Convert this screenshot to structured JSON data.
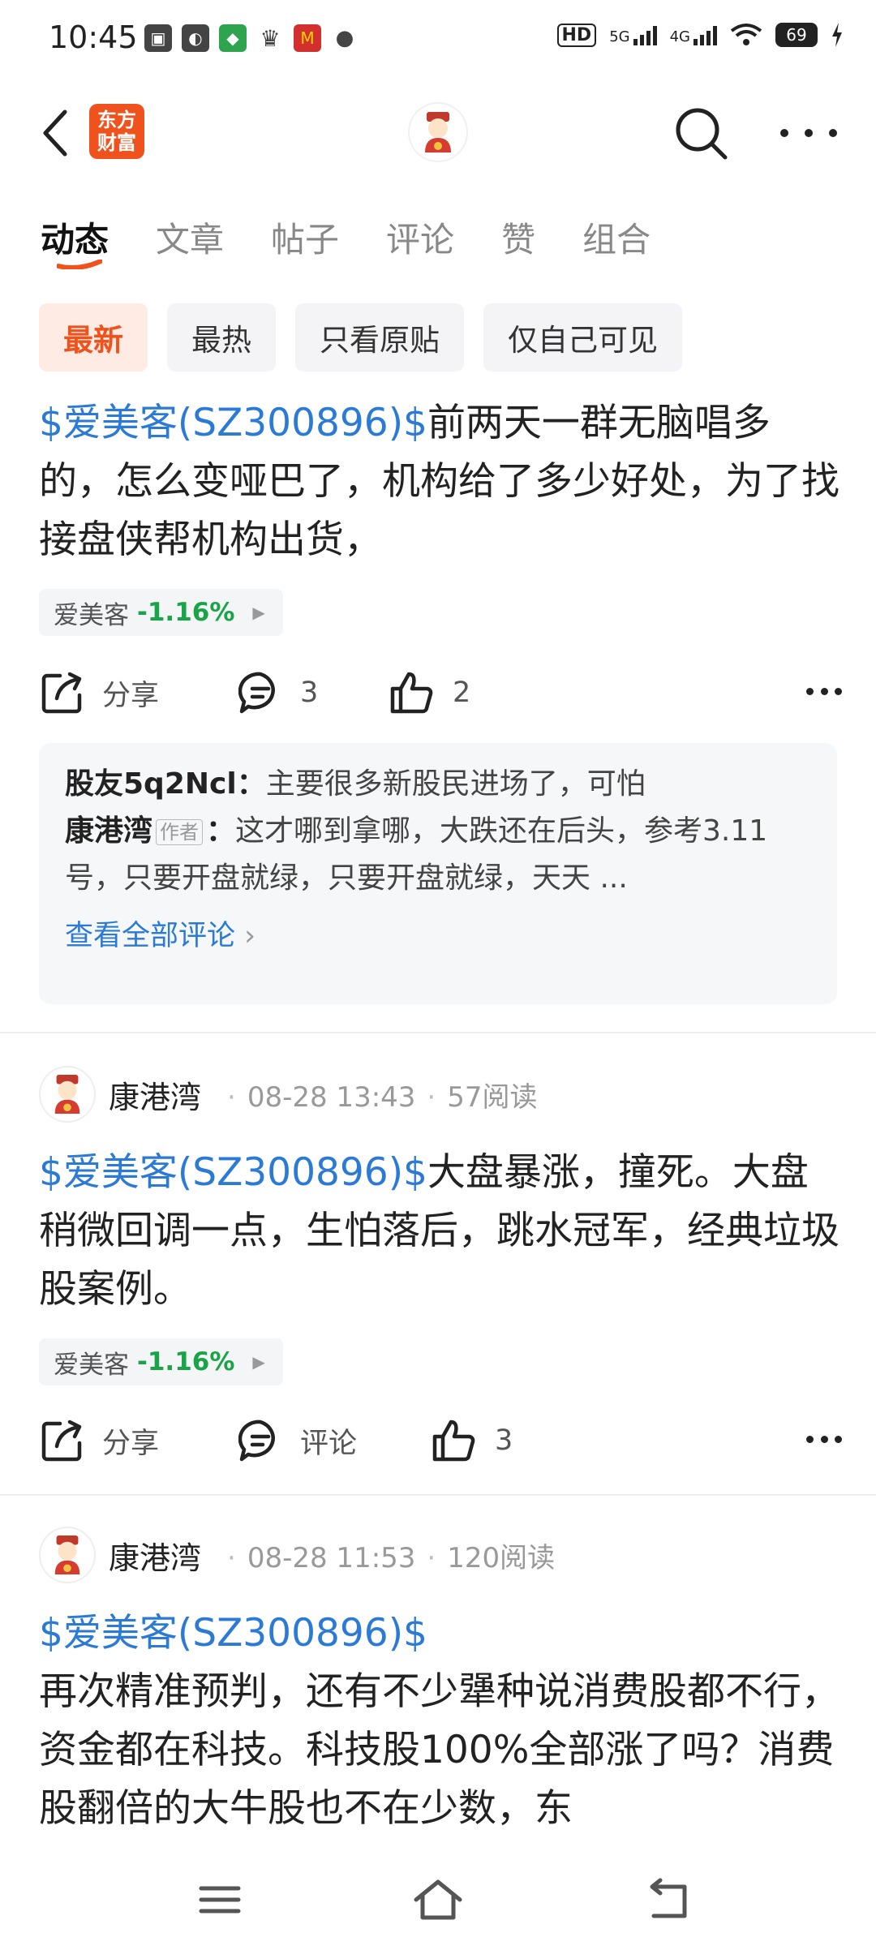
{
  "status_bar": {
    "time": "10:45",
    "network_5g": "5G",
    "network_4g": "4G",
    "battery": "69",
    "icons": [
      "cast-icon",
      "app-icon",
      "green-app-icon",
      "crown-icon",
      "mcdonalds-icon",
      "wechat-icon",
      "hd-icon",
      "wifi-icon",
      "charging-icon"
    ]
  },
  "header": {
    "logo_text": "东方财富",
    "icons": [
      "back-icon",
      "search-icon",
      "more-icon"
    ]
  },
  "tabs": [
    {
      "label": "动态",
      "active": true
    },
    {
      "label": "文章",
      "active": false
    },
    {
      "label": "帖子",
      "active": false
    },
    {
      "label": "评论",
      "active": false
    },
    {
      "label": "赞",
      "active": false
    },
    {
      "label": "组合",
      "active": false
    }
  ],
  "filters": [
    {
      "label": "最新",
      "active": true
    },
    {
      "label": "最热",
      "active": false
    },
    {
      "label": "只看原贴",
      "active": false
    },
    {
      "label": "仅自己可见",
      "active": false
    }
  ],
  "colors": {
    "accent": "#f0521e",
    "link": "#2a7ad6",
    "down_green": "#19a448"
  },
  "posts": [
    {
      "stock_link": "$爱美客(SZ300896)$",
      "text": "前两天一群无脑唱多的，怎么变哑巴了，机构给了多少好处，为了找接盘侠帮机构出货，",
      "tag_name": "爱美客",
      "tag_change": "-1.16%",
      "share_label": "分享",
      "comment_count": "3",
      "like_count": "2",
      "comments": {
        "first_user": "股友5q2Ncl",
        "first_text": "主要很多新股民进场了，可怕",
        "second_user": "康港湾",
        "second_badge": "作者",
        "second_text": "这才哪到拿哪，大跌还在后头，参考3.11号，只要开盘就绿，只要开盘就绿，天天 ...",
        "view_all": "查看全部评论"
      }
    },
    {
      "author": "康港湾",
      "time": "08-28 13:43",
      "reads": "57阅读",
      "stock_link": "$爱美客(SZ300896)$",
      "text": "大盘暴涨，撞死。大盘稍微回调一点，生怕落后，跳水冠军，经典垃圾股案例。",
      "tag_name": "爱美客",
      "tag_change": "-1.16%",
      "share_label": "分享",
      "comment_label": "评论",
      "like_count": "3"
    },
    {
      "author": "康港湾",
      "time": "08-28 11:53",
      "reads": "120阅读",
      "stock_link": "$爱美客(SZ300896)$",
      "text": "再次精准预判，还有不少犟种说消费股都不行，资金都在科技。科技股100%全部涨了吗？消费股翻倍的大牛股也不在少数，东"
    }
  ]
}
